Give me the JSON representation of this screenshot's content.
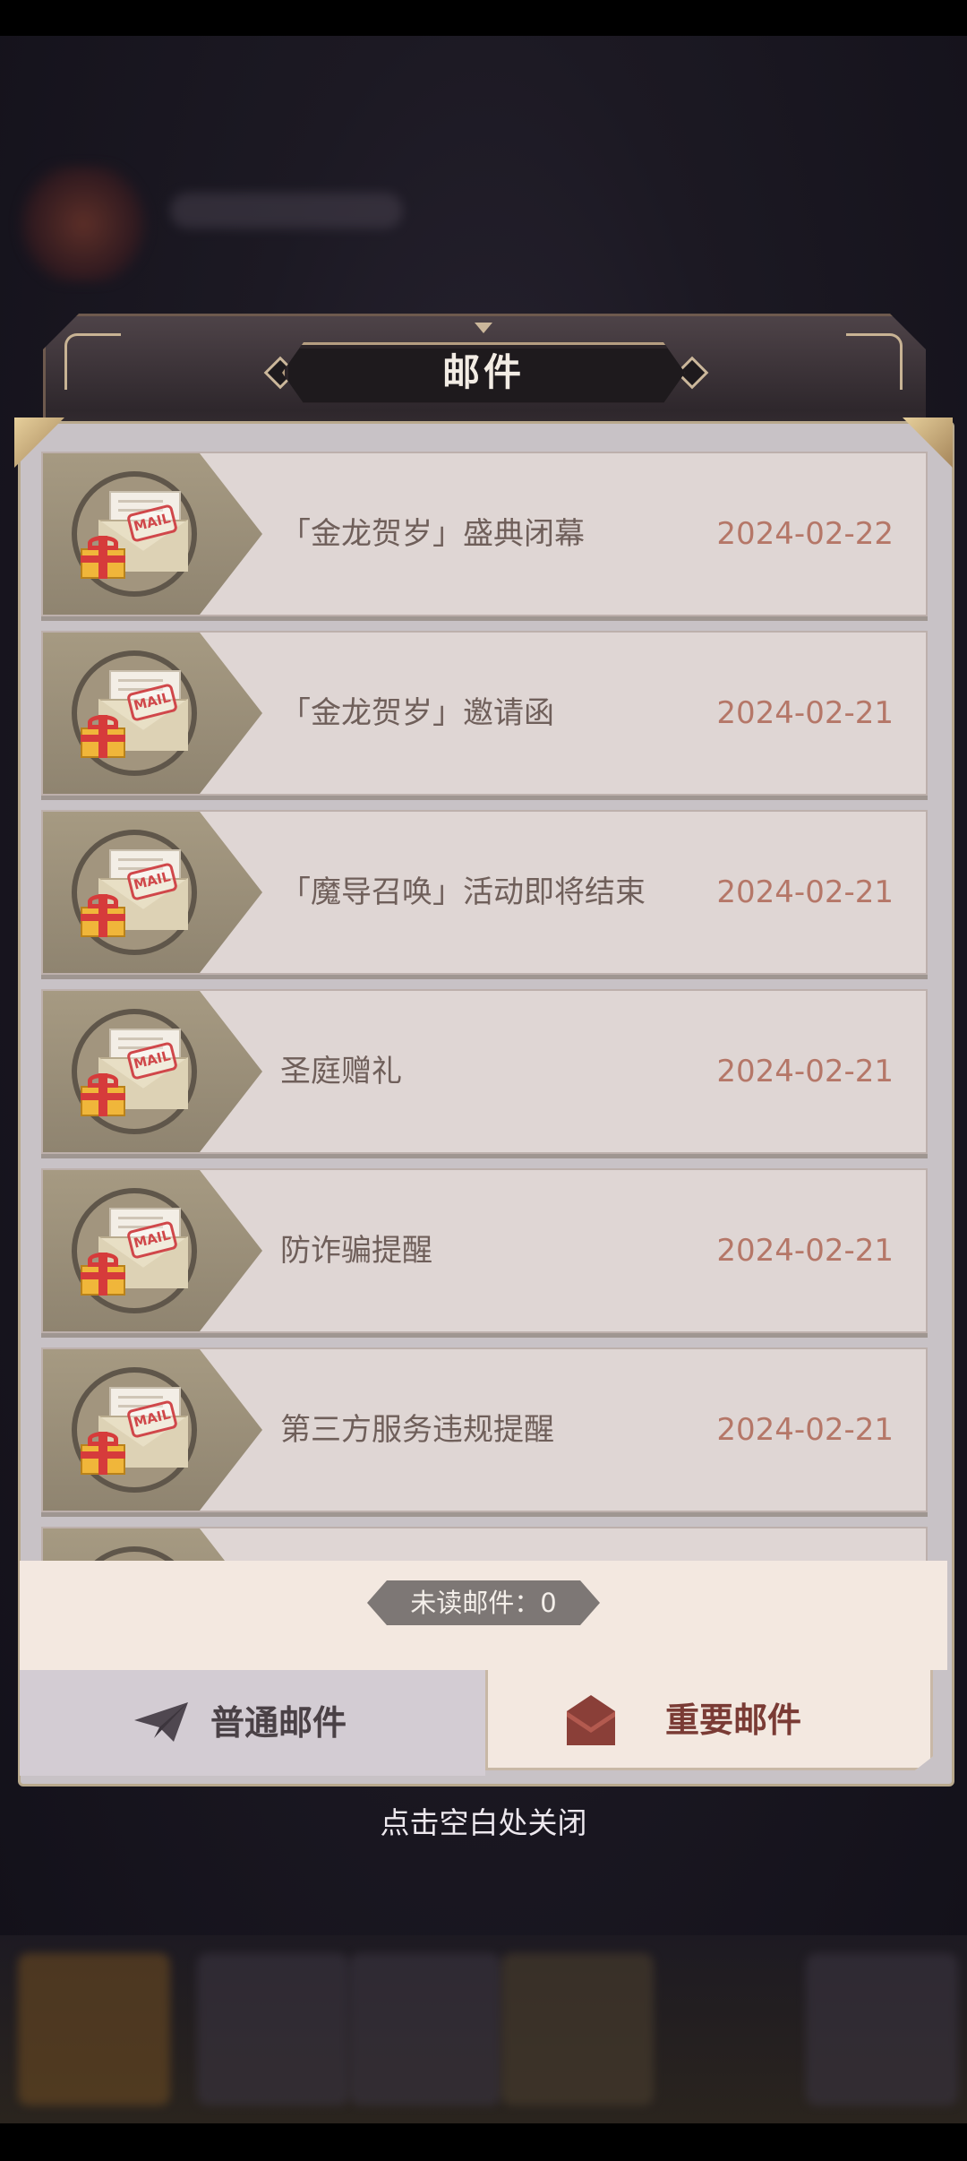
{
  "dialog": {
    "title": "邮件"
  },
  "mails": [
    {
      "subject": "「金龙贺岁」盛典闭幕",
      "date": "2024-02-22"
    },
    {
      "subject": "「金龙贺岁」邀请函",
      "date": "2024-02-21"
    },
    {
      "subject": "「魔导召唤」活动即将结束",
      "date": "2024-02-21"
    },
    {
      "subject": "圣庭赠礼",
      "date": "2024-02-21"
    },
    {
      "subject": "防诈骗提醒",
      "date": "2024-02-21"
    },
    {
      "subject": "第三方服务违规提醒",
      "date": "2024-02-21"
    }
  ],
  "mail_icon": {
    "stamp_text": "MAIL",
    "icon_name": "mail-gift-icon"
  },
  "footer": {
    "unread_label": "未读邮件：0"
  },
  "tabs": {
    "normal": {
      "label": "普通邮件",
      "icon": "paper-plane-icon"
    },
    "important": {
      "label": "重要邮件",
      "icon": "envelope-icon",
      "active": true
    }
  },
  "close_hint": "点击空白处关闭",
  "colors": {
    "date": "#b57768",
    "subject": "#6f5f5a",
    "important_tab_text": "#7a3b35",
    "panel_border": "#b9a98d"
  }
}
